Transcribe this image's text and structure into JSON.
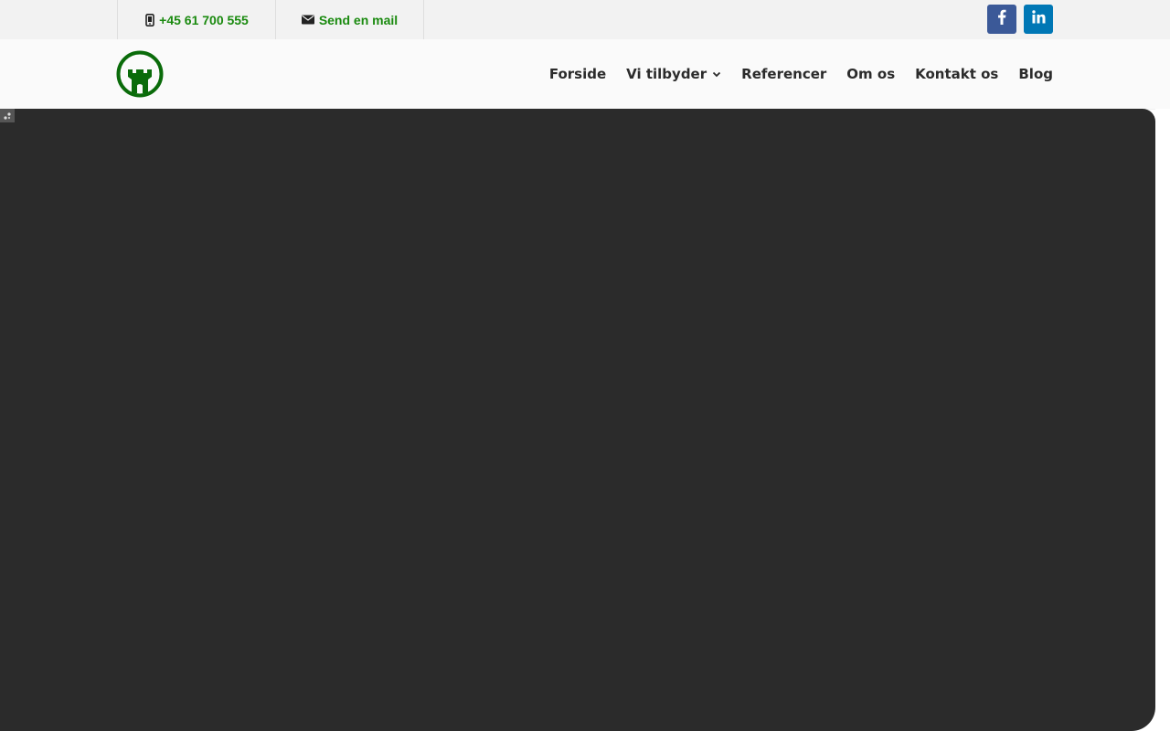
{
  "topbar": {
    "phone_icon": "mobile-phone-icon",
    "phone": "+45 61 700 555",
    "mail_icon": "envelope-icon",
    "mail": "Send en mail",
    "link_color": "#1a8a0f",
    "social": [
      {
        "name": "facebook",
        "icon": "facebook-icon",
        "color": "#3b5998"
      },
      {
        "name": "linkedin",
        "icon": "linkedin-icon",
        "color": "#0077b5"
      }
    ]
  },
  "header": {
    "logo_icon": "castle-tower-logo-icon",
    "logo_color": "#0a6b0a",
    "nav": [
      {
        "label": "Forside"
      },
      {
        "label": "Vi tilbyder",
        "has_dropdown": true
      },
      {
        "label": "Referencer"
      },
      {
        "label": "Om os"
      },
      {
        "label": "Kontakt os"
      },
      {
        "label": "Blog"
      }
    ]
  },
  "hero": {
    "background": "#2b2b2b"
  }
}
